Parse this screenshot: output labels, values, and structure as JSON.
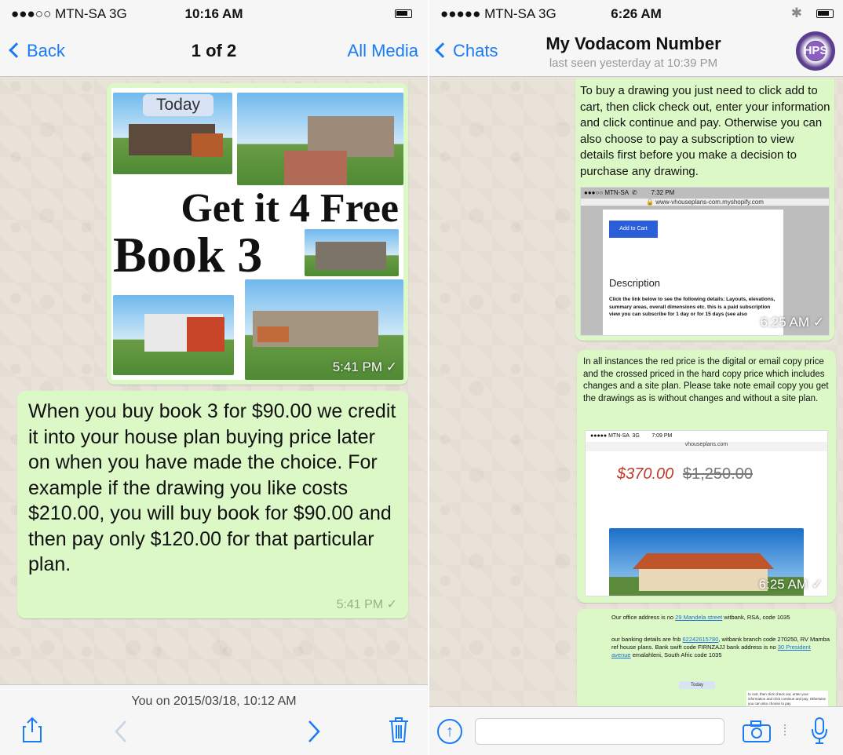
{
  "left": {
    "status": {
      "carrier": "●●●○○ MTN-SA  3G",
      "time": "10:16 AM"
    },
    "nav": {
      "back": "Back",
      "title": "1 of 2",
      "right": "All Media"
    },
    "image": {
      "badge": "Today",
      "headline1": "Get it 4 Free",
      "headline2": "Book 3",
      "time": "5:41 PM ✓"
    },
    "message": {
      "text": "When you buy book 3 for $90.00 we credit it into your house plan buying price later on when you have made the choice. For example if the drawing you like costs $210.00, you will buy book for  $90.00 and then pay only $120.00 for that particular plan.",
      "time": "5:41 PM ✓"
    },
    "footer": {
      "meta": "You on 2015/03/18, 10:12 AM"
    },
    "icons": [
      "share-icon",
      "prev-arrow-icon",
      "next-arrow-icon",
      "trash-icon"
    ]
  },
  "right": {
    "status": {
      "carrier": "●●●●● MTN-SA  3G",
      "time": "6:26 AM",
      "bt": "✱"
    },
    "nav": {
      "back": "Chats",
      "title": "My Vodacom Number",
      "subtitle": "last seen yesterday at 10:39 PM",
      "avatar": "HPS"
    },
    "msg1": {
      "text": "To buy a drawing you just need to click add to cart, then click check out, enter your information and click continue and pay. Otherwise you can also choose to pay a subscription to view details first before you make a decision to purchase any drawing.",
      "shot_status": "●●●○○ MTN-SA  ✆        7:32 PM",
      "shot_url": "🔒 www-vhouseplans-com.myshopify.com",
      "shot_button": "Add to Cart",
      "shot_heading": "Description",
      "shot_body": "Click the link below to see the following details: Layouts, elevations, summary areas, overall dimensions etc. this is a paid subscription view you can subscribe for 1 day or for 15 days (see also",
      "time": "6:25 AM ✓"
    },
    "msg2": {
      "text": "In all instances the red price is the digital or email copy price and the crossed priced in the hard copy price which includes changes and a site plan. Please take note email copy you get the drawings as is without changes and without a site plan.",
      "shot_status": "●●●●● MTN-SA  3G        7:09 PM",
      "shot_url": "vhouseplans.com",
      "price_red": "$370.00",
      "price_crossed": "$1,250.00",
      "time": "6:25 AM ✓"
    },
    "msg3": {
      "line1a": "Our office address is no ",
      "line1b": "29 Mandela street",
      "line1c": " witbank, RSA, code 1035",
      "line2a": "our banking details are fnb ",
      "line2b": "62242615780",
      "line2c": ", witbank branch code 270250, RV Mamba ref house plans. Bank swift code FIRNZAJJ bank address is no ",
      "line2d": "30 President avenue",
      "line2e": " emalahleni, South Afric code 1035",
      "badge": "Today",
      "mini": "to cart, then click check out, enter your information and click continue and pay. Otherwise you can also choose to pay"
    },
    "input": {
      "placeholder": ""
    },
    "icons": [
      "upload-icon",
      "camera-icon",
      "microphone-icon"
    ]
  }
}
